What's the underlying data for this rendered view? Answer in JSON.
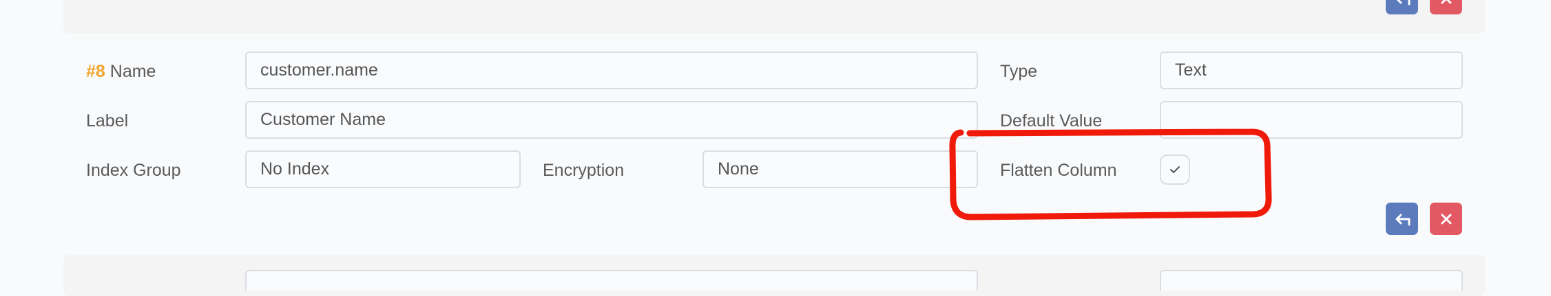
{
  "row": {
    "number": "#8",
    "name_label": "Name",
    "name_value": "customer.name",
    "type_label": "Type",
    "type_value": "Text",
    "label_label": "Label",
    "label_value": "Customer Name",
    "default_label": "Default Value",
    "default_value": "",
    "index_label": "Index Group",
    "index_value": "No Index",
    "encryption_label": "Encryption",
    "encryption_value": "None",
    "flatten_label": "Flatten Column",
    "flatten_checked": true
  },
  "colors": {
    "accent_number": "#f0a42a",
    "undo_button": "#5b7bbd",
    "delete_button": "#e25963",
    "annotation": "#f01a0a"
  },
  "icons": {
    "undo": "undo-arrow-icon",
    "delete": "close-x-icon",
    "check": "checkmark-icon"
  }
}
